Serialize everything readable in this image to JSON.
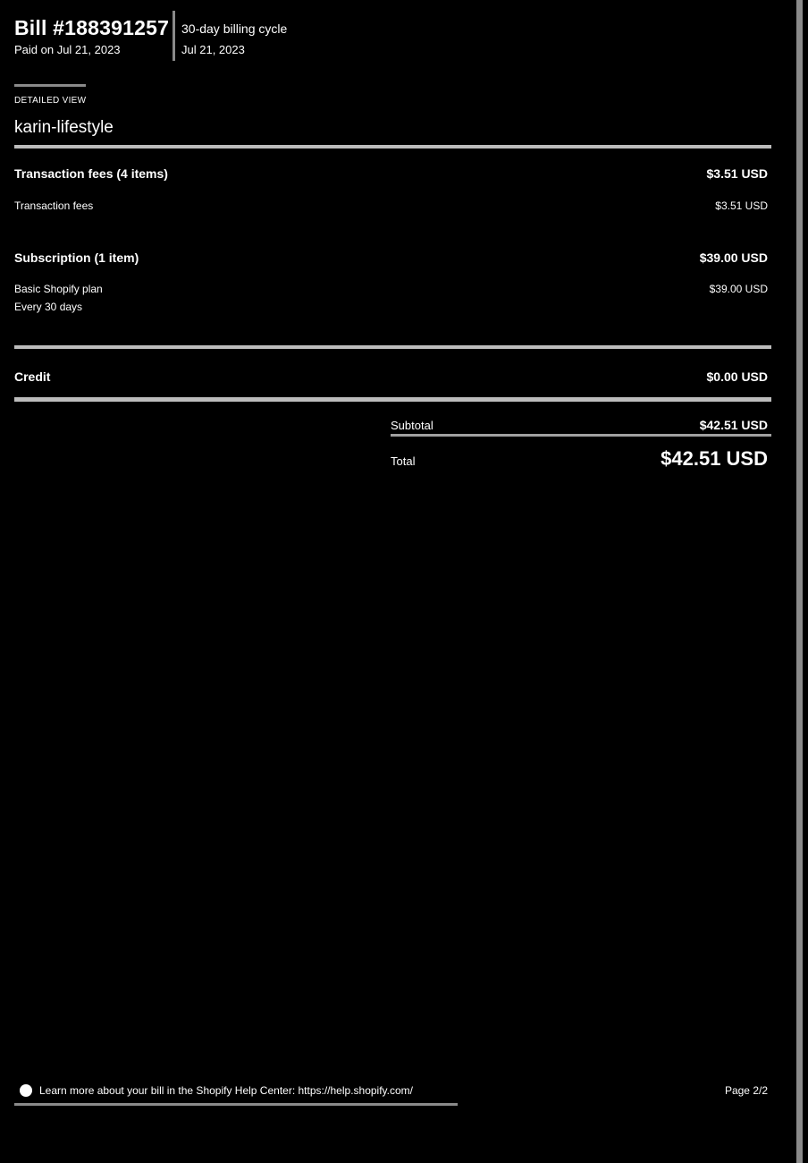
{
  "header": {
    "bill_title": "Bill #188391257",
    "paid_on": "Paid on Jul 21, 2023",
    "billing_cycle": "30-day billing cycle",
    "cycle_date": "Jul 21, 2023"
  },
  "view_label": "DETAILED VIEW",
  "store_name": "karin-lifestyle",
  "sections": {
    "transaction_fees": {
      "heading": "Transaction fees (4 items)",
      "heading_amount": "$3.51 USD",
      "item_label": "Transaction fees",
      "item_amount": "$3.51 USD"
    },
    "subscription": {
      "heading": "Subscription (1 item)",
      "heading_amount": "$39.00 USD",
      "item_label": "Basic Shopify plan",
      "item_amount": "$39.00 USD",
      "item_note": "Every 30 days"
    },
    "credit": {
      "label": "Credit",
      "amount": "$0.00 USD"
    }
  },
  "totals": {
    "subtotal_label": "Subtotal",
    "subtotal_amount": "$42.51 USD",
    "total_label": "Total",
    "total_amount": "$42.51 USD"
  },
  "footer": {
    "info_icon": "info-icon",
    "help_text": "Learn more about your bill in the Shopify Help Center: https://help.shopify.com/",
    "page_indicator": "Page 2/2"
  }
}
